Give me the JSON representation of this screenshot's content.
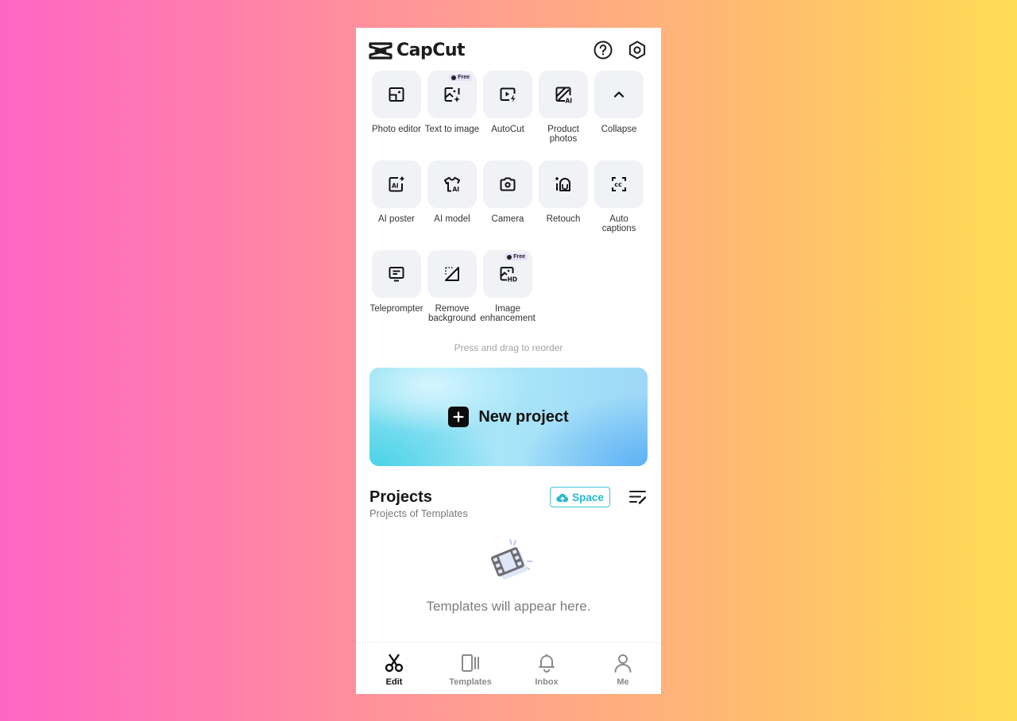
{
  "header": {
    "app_name": "CapCut",
    "icons": [
      "capcut-logo-icon",
      "help-icon",
      "settings-icon"
    ]
  },
  "tools": [
    {
      "label": "Photo editor",
      "icon": "photo-editor-icon",
      "badge": null
    },
    {
      "label": "Text to image",
      "icon": "text-to-image-icon",
      "badge": "Free"
    },
    {
      "label": "AutoCut",
      "icon": "autocut-icon",
      "badge": null
    },
    {
      "label": "Product\nphotos",
      "icon": "product-photos-icon",
      "badge": null
    },
    {
      "label": "Collapse",
      "icon": "chevron-up-icon",
      "badge": null
    },
    {
      "label": "AI poster",
      "icon": "ai-poster-icon",
      "badge": null
    },
    {
      "label": "AI model",
      "icon": "ai-model-icon",
      "badge": null
    },
    {
      "label": "Camera",
      "icon": "camera-icon",
      "badge": null
    },
    {
      "label": "Retouch",
      "icon": "retouch-icon",
      "badge": null
    },
    {
      "label": "Auto\ncaptions",
      "icon": "auto-captions-icon",
      "badge": null
    },
    {
      "label": "Teleprompter",
      "icon": "teleprompter-icon",
      "badge": null
    },
    {
      "label": "Remove\nbackground",
      "icon": "remove-background-icon",
      "badge": null
    },
    {
      "label": "Image\nenhancement",
      "icon": "image-enhancement-icon",
      "badge": "Free"
    }
  ],
  "hint": "Press and drag to reorder",
  "new_project": {
    "label": "New project"
  },
  "projects": {
    "title": "Projects",
    "subtitle": "Projects of Templates",
    "space_label": "Space",
    "empty_text": "Templates will appear here."
  },
  "tabbar": {
    "active": "Edit",
    "items": [
      {
        "label": "Edit",
        "icon": "scissors-icon"
      },
      {
        "label": "Templates",
        "icon": "templates-icon"
      },
      {
        "label": "Inbox",
        "icon": "bell-icon"
      },
      {
        "label": "Me",
        "icon": "person-icon"
      }
    ]
  },
  "colors": {
    "accent": "#27b9cf",
    "tile_bg": "#f1f2f5",
    "free_badge_bg": "#e8e0fb"
  }
}
